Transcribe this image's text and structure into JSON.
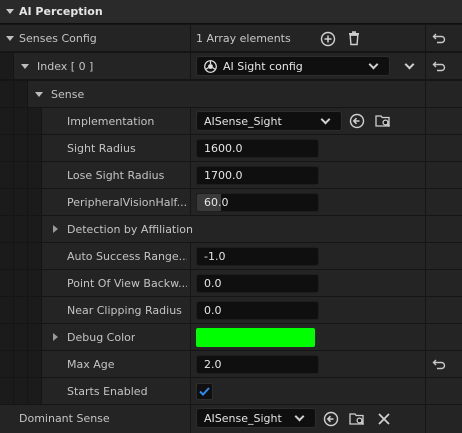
{
  "section": {
    "title": "AI Perception"
  },
  "senses_config": {
    "label": "Senses Config",
    "value": "1 Array elements"
  },
  "index0": {
    "label": "Index [ 0 ]",
    "value": "AI Sight config"
  },
  "sense": {
    "label": "Sense"
  },
  "properties": {
    "implementation": {
      "label": "Implementation",
      "value": "AISense_Sight"
    },
    "sight_radius": {
      "label": "Sight Radius",
      "value": "1600.0"
    },
    "lose_sight_radius": {
      "label": "Lose Sight Radius",
      "value": "1700.0"
    },
    "peripheral_vision": {
      "label": "PeripheralVisionHalf...",
      "value": "60.0",
      "fill": 0.2
    },
    "detection_by_affiliation": {
      "label": "Detection by Affiliation"
    },
    "auto_success_range": {
      "label": "Auto Success Range...",
      "value": "-1.0"
    },
    "point_of_view_backward": {
      "label": "Point Of View Backw...",
      "value": "0.0"
    },
    "near_clipping_radius": {
      "label": "Near Clipping Radius",
      "value": "0.0"
    },
    "debug_color": {
      "label": "Debug Color",
      "color": "#00ff00"
    },
    "max_age": {
      "label": "Max Age",
      "value": "2.0"
    },
    "starts_enabled": {
      "label": "Starts Enabled",
      "checked": true
    }
  },
  "dominant_sense": {
    "label": "Dominant Sense",
    "value": "AISense_Sight"
  },
  "colors": {
    "accent_blue": "#2d8bf0",
    "debug_green": "#00ff00"
  },
  "icons": {
    "add": "add-icon",
    "delete": "trash-icon",
    "reset": "reset-to-default-icon",
    "browse": "browse-arrow-icon",
    "find": "find-in-browser-icon",
    "clear": "clear-icon",
    "asset": "asset-type-icon"
  }
}
